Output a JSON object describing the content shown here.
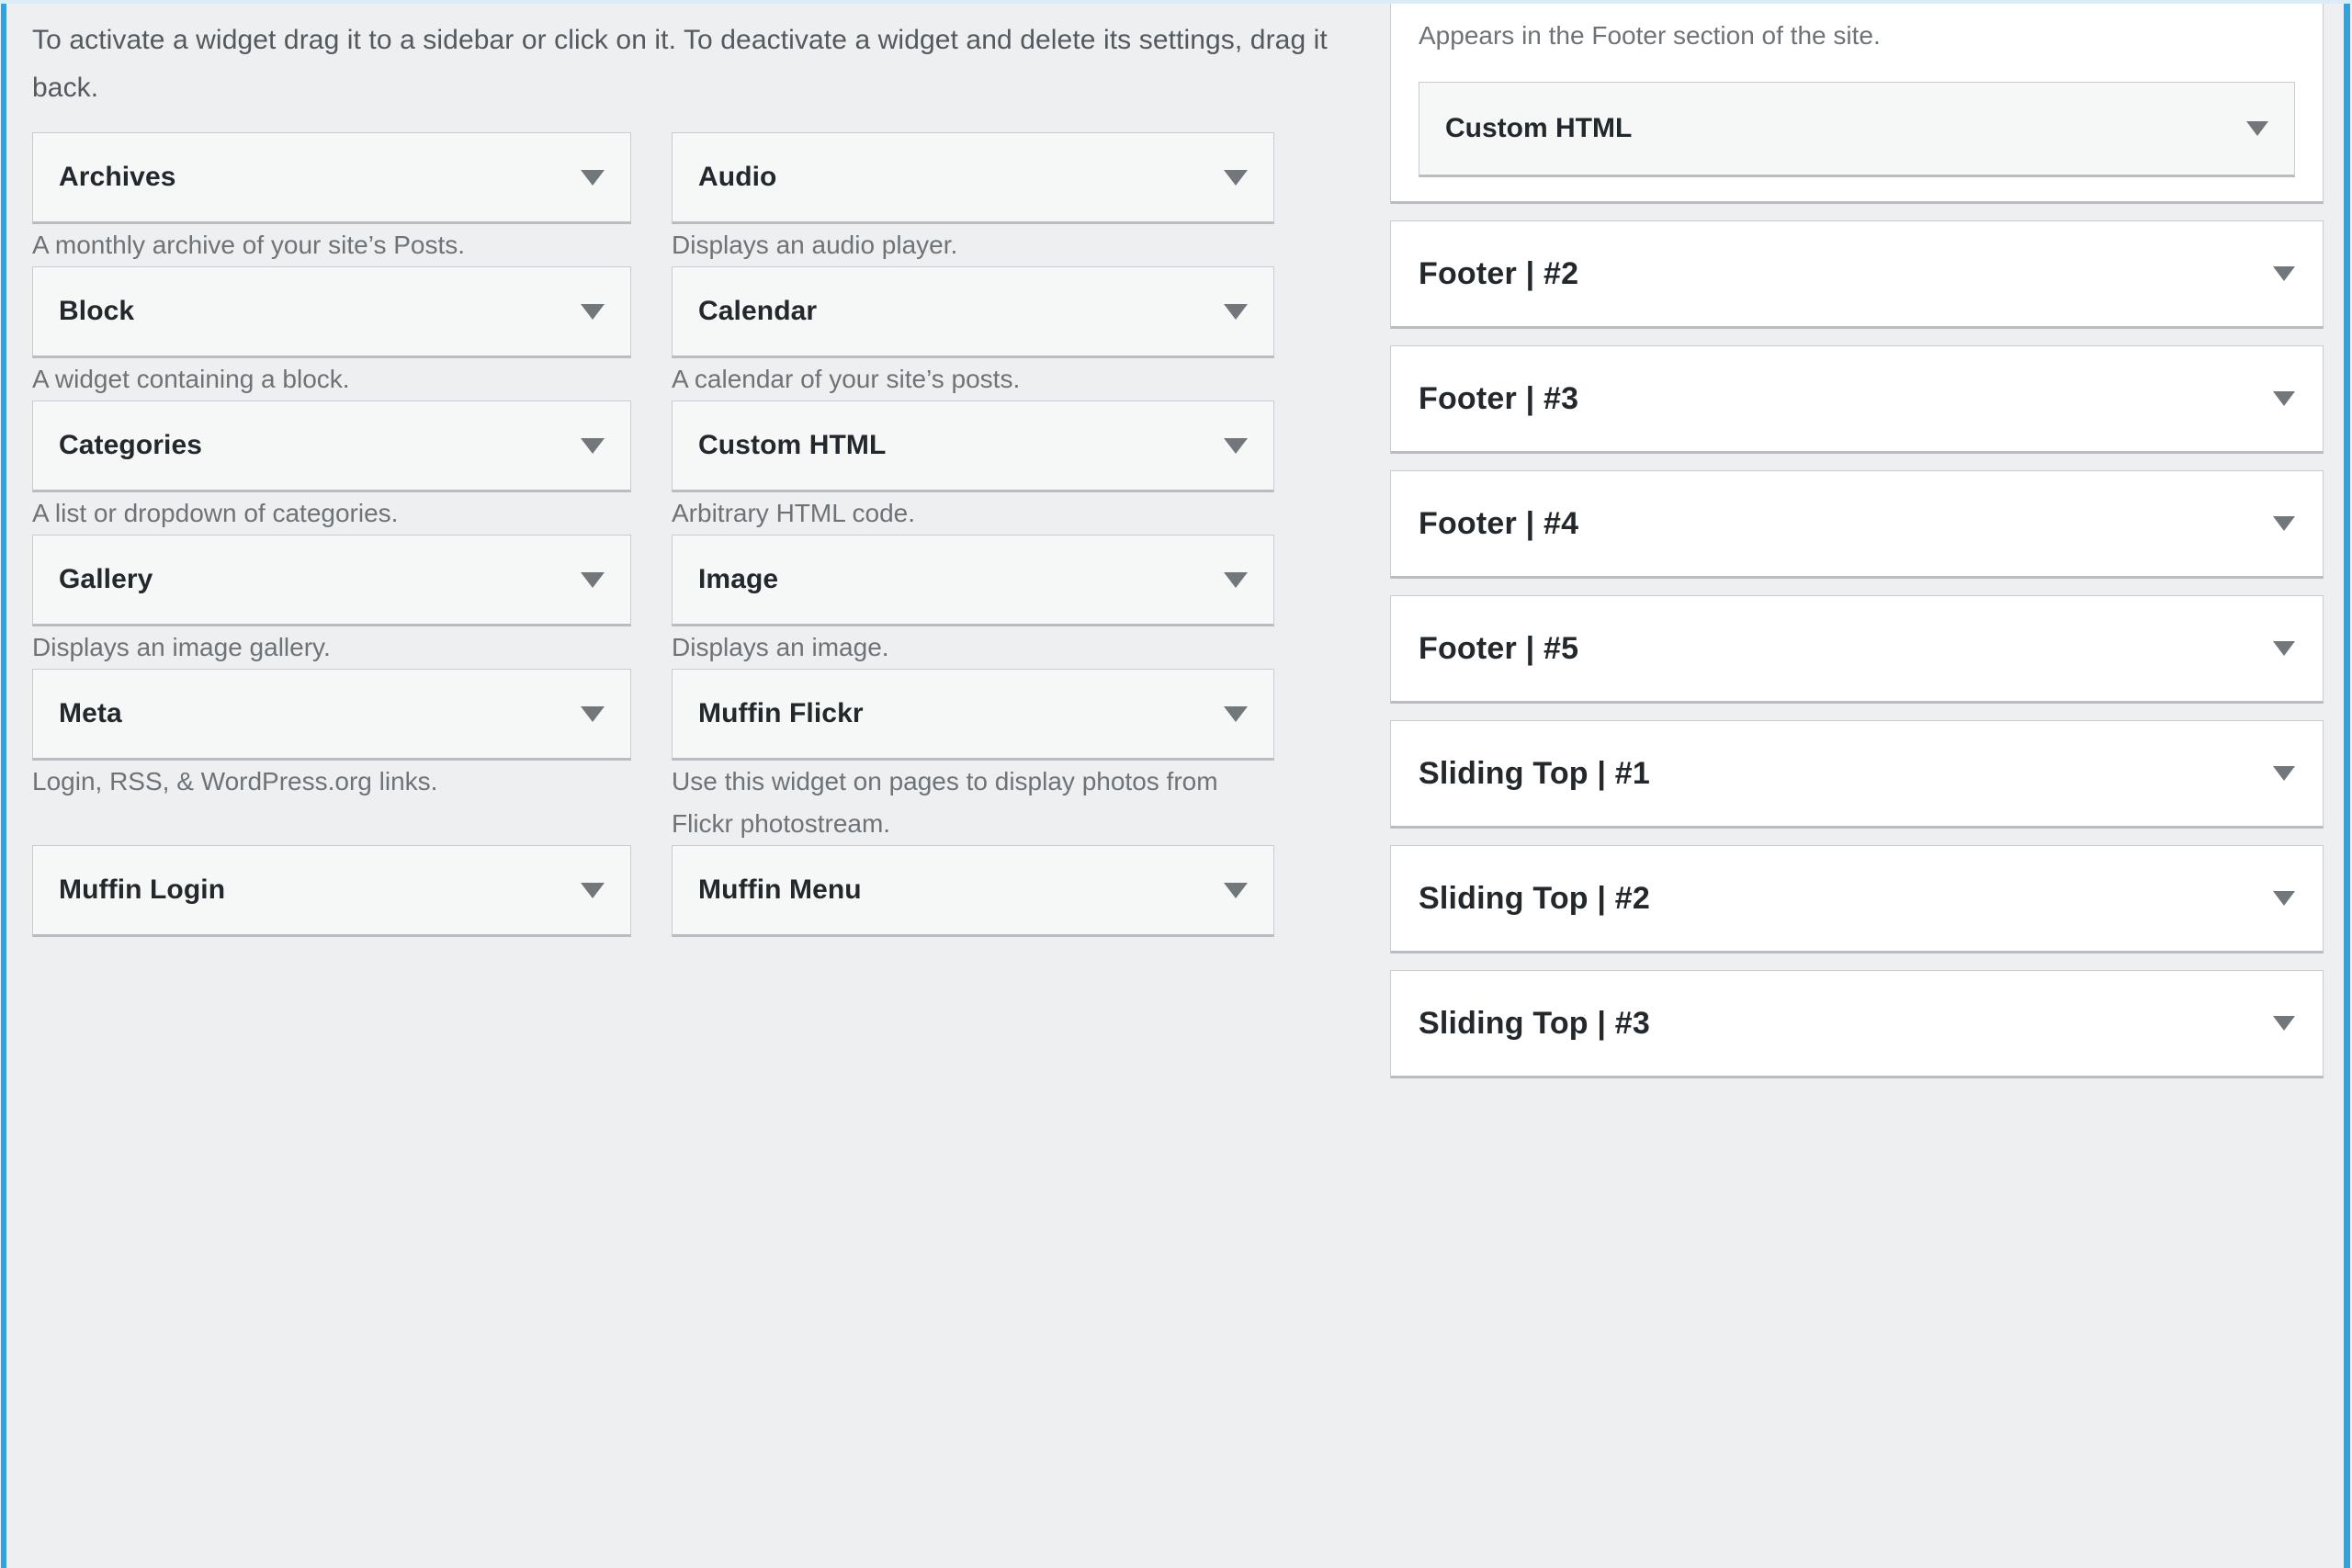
{
  "available_widgets": {
    "intro": "To activate a widget drag it to a sidebar or click on it. To deactivate a widget and delete its settings, drag it back.",
    "caret_icon": "chevron-down-icon",
    "rows": [
      {
        "left": {
          "title": "Archives",
          "desc": "A monthly archive of your site’s Posts."
        },
        "right": {
          "title": "Audio",
          "desc": "Displays an audio player."
        }
      },
      {
        "left": {
          "title": "Block",
          "desc": "A widget containing a block."
        },
        "right": {
          "title": "Calendar",
          "desc": "A calendar of your site’s posts."
        }
      },
      {
        "left": {
          "title": "Categories",
          "desc": "A list or dropdown of categories."
        },
        "right": {
          "title": "Custom HTML",
          "desc": "Arbitrary HTML code."
        }
      },
      {
        "left": {
          "title": "Gallery",
          "desc": "Displays an image gallery."
        },
        "right": {
          "title": "Image",
          "desc": "Displays an image."
        }
      },
      {
        "left": {
          "title": "Meta",
          "desc": "Login, RSS, & WordPress.org links."
        },
        "right": {
          "title": "Muffin Flickr",
          "desc": "Use this widget on pages to display photos from Flickr photostream."
        }
      },
      {
        "left": {
          "title": "Muffin Login",
          "desc": ""
        },
        "right": {
          "title": "Muffin Menu",
          "desc": ""
        }
      }
    ]
  },
  "sidebars": {
    "caret_icon": "chevron-down-icon",
    "open_sidebar": {
      "note": "Appears in the Footer section of the site.",
      "widgets": [
        {
          "title": "Custom HTML"
        }
      ]
    },
    "collapsed": [
      {
        "title": "Footer | #2"
      },
      {
        "title": "Footer | #3"
      },
      {
        "title": "Footer | #4"
      },
      {
        "title": "Footer | #5"
      },
      {
        "title": "Sliding Top | #1"
      },
      {
        "title": "Sliding Top | #2"
      },
      {
        "title": "Sliding Top | #3"
      }
    ]
  },
  "colors": {
    "accent_blue": "#2ea3e0",
    "page_background": "#eeeff0",
    "card_background": "#f6f7f7",
    "panel_background": "#ffffff",
    "border_gray": "#c9cdd1",
    "text_primary": "#23282d",
    "text_muted": "#6e7378"
  }
}
